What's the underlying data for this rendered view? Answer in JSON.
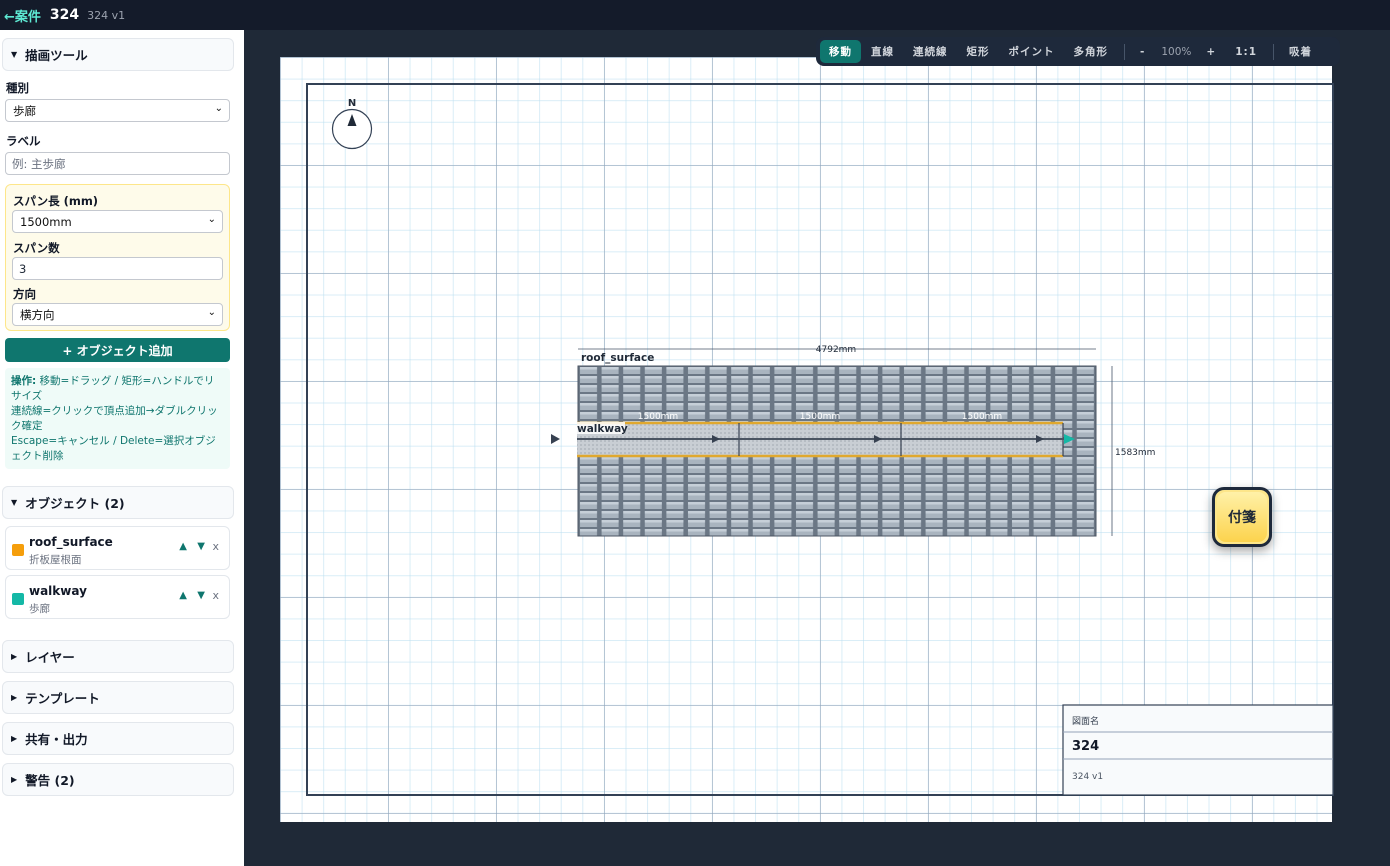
{
  "topbar": {
    "back_label": "←案件",
    "title": "324",
    "version": "324 v1"
  },
  "sidebar": {
    "draw_tools": {
      "header": "描画ツール"
    },
    "type_label": "種別",
    "type_value": "歩廊",
    "label_label": "ラベル",
    "label_placeholder": "例: 主歩廊",
    "span_length_label": "スパン長 (mm)",
    "span_length_value": "1500mm",
    "span_count_label": "スパン数",
    "span_count_value": "3",
    "direction_label": "方向",
    "direction_value": "横方向",
    "add_button": "+ オブジェクト追加",
    "help": {
      "line1_bold": "操作:",
      "line1": " 移動=ドラッグ / 矩形=ハンドルでリサイズ",
      "line2": "連続線=クリックで頂点追加→ダブルクリック確定",
      "line3": "Escape=キャンセル / Delete=選択オブジェクト削除"
    },
    "objects_header": "オブジェクト (2)",
    "objects": [
      {
        "name": "roof_surface",
        "sub": "折板屋根面",
        "color": "#f59e0b"
      },
      {
        "name": "walkway",
        "sub": "歩廊",
        "color": "#14b8a6"
      }
    ],
    "obj_up": "▲",
    "obj_down": "▼",
    "obj_remove": "x",
    "layers_header": "レイヤー",
    "templates_header": "テンプレート",
    "share_header": "共有・出力",
    "warnings_header": "警告 (2)"
  },
  "toolbar": {
    "move": "移動",
    "line": "直線",
    "polyline": "連続線",
    "rect": "矩形",
    "point": "ポイント",
    "polygon": "多角形",
    "zoom_out": "-",
    "zoom_level": "100%",
    "zoom_in": "+",
    "reset": "1:1",
    "snap": "吸着"
  },
  "drawing": {
    "north": "N",
    "roof_label": "roof_surface",
    "walkway_label": "walkway",
    "width_dim": "4792mm",
    "height_dim": "1583mm",
    "spans": [
      "1500mm",
      "1500mm",
      "1500mm"
    ],
    "title_block": {
      "label": "図面名",
      "name": "324",
      "version": "324 v1"
    }
  },
  "sticky_note": "付箋"
}
